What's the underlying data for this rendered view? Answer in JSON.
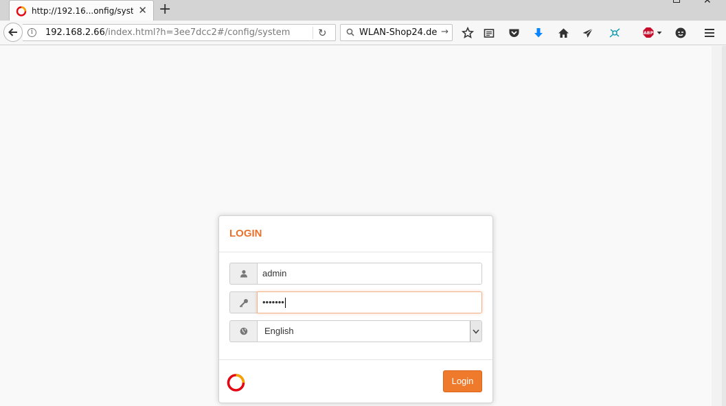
{
  "browser": {
    "tab": {
      "title": "http://192.16...onfig/system"
    },
    "url": {
      "host": "192.168.2.66",
      "path": "/index.html?h=3ee7dcc2#/config/system"
    },
    "search": {
      "engine_text": "WLAN-Shop24.de"
    },
    "toolbar_icons": [
      "star-icon",
      "reading-list-icon",
      "pocket-icon",
      "download-icon",
      "home-icon",
      "send-icon",
      "network-icon",
      "adblock-plus-icon",
      "chat-icon",
      "menu-icon"
    ],
    "adblock_label": "ABP"
  },
  "login": {
    "title": "LOGIN",
    "username": "admin",
    "password_masked": "•••••••",
    "language": "English",
    "button_label": "Login"
  },
  "colors": {
    "accent": "#e8722c",
    "button": "#ef7a2c",
    "brand_red": "#e30613"
  }
}
